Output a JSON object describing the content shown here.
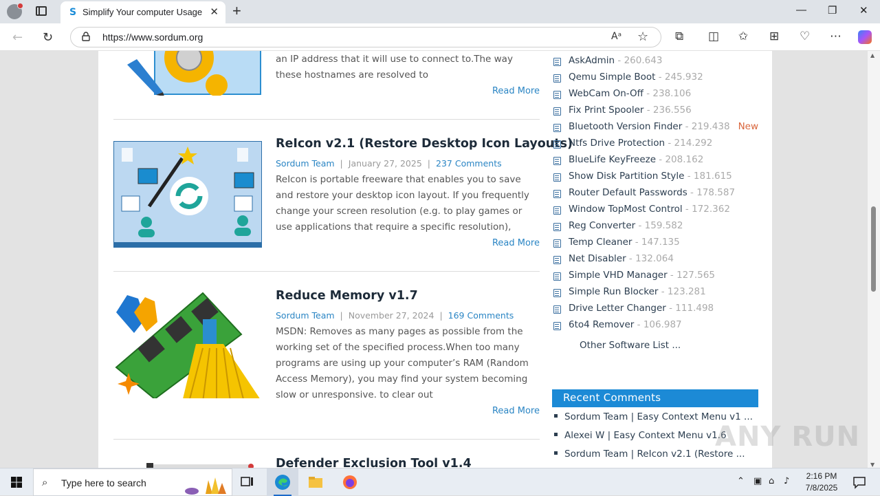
{
  "browser": {
    "tab_title": "Simplify Your computer Usage",
    "url": "https://www.sordum.org",
    "new_tab": "+",
    "tab_close": "✕",
    "read_aloud": "Aᵃ",
    "win_min": "—",
    "win_max": "❐",
    "win_close": "✕"
  },
  "posts": [
    {
      "title": "",
      "excerpt": "an IP address that it will use to connect to.The way these hostnames are resolved to",
      "read_more": "Read More"
    },
    {
      "title": "ReIcon v2.1 (Restore Desktop Icon Layouts)",
      "author": "Sordum Team",
      "date": "January 27, 2025",
      "comments": "237 Comments",
      "excerpt": "ReIcon is portable freeware that enables you to save and restore your desktop icon layout. If you frequently change your screen resolution (e.g. to play games or use applications that require a specific resolution),",
      "read_more": "Read More"
    },
    {
      "title": "Reduce Memory v1.7",
      "author": "Sordum Team",
      "date": "November 27, 2024",
      "comments": "169 Comments",
      "excerpt": "MSDN: Removes as many pages as possible from the working set of the specified process.When too many programs are using up your computer’s RAM (Random Access Memory), you may find your system becoming slow or unresponsive. to clear out",
      "read_more": "Read More"
    },
    {
      "title": "Defender Exclusion Tool v1.4"
    }
  ],
  "meta_sep": "|",
  "sidebar": {
    "software": [
      {
        "name": "AskAdmin",
        "count": " - 260.643"
      },
      {
        "name": "Qemu Simple Boot",
        "count": " - 245.932"
      },
      {
        "name": "WebCam On-Off",
        "count": " - 238.106"
      },
      {
        "name": "Fix Print Spooler",
        "count": " - 236.556"
      },
      {
        "name": "Bluetooth Version Finder",
        "count": " - 219.438",
        "badge": "New"
      },
      {
        "name": "Ntfs Drive Protection",
        "count": " - 214.292"
      },
      {
        "name": "BlueLife KeyFreeze",
        "count": " - 208.162"
      },
      {
        "name": "Show Disk Partition Style",
        "count": " - 181.615"
      },
      {
        "name": "Router Default Passwords",
        "count": " - 178.587"
      },
      {
        "name": "Window TopMost Control",
        "count": " - 172.362"
      },
      {
        "name": "Reg Converter",
        "count": " - 159.582"
      },
      {
        "name": "Temp Cleaner",
        "count": " - 147.135"
      },
      {
        "name": "Net Disabler",
        "count": " - 132.064"
      },
      {
        "name": "Simple VHD Manager",
        "count": " - 127.565"
      },
      {
        "name": "Simple Run Blocker",
        "count": " - 123.281"
      },
      {
        "name": "Drive Letter Changer",
        "count": " - 111.498"
      },
      {
        "name": "6to4 Remover",
        "count": " - 106.987"
      }
    ],
    "other_list": "Other Software List ...",
    "recent_title": "Recent Comments",
    "recent": [
      "Sordum Team | Easy Context Menu v1 ...",
      "Alexei W | Easy Context Menu v1.6",
      "Sordum Team | ReIcon v2.1 (Restore ..."
    ]
  },
  "watermark": "ANY RUN",
  "taskbar": {
    "search_placeholder": "Type here to search",
    "time": "2:16 PM",
    "date": "7/8/2025"
  },
  "colors": {
    "accent": "#1c8ad6",
    "link": "#2a85c4",
    "new_badge": "#d9653b"
  }
}
